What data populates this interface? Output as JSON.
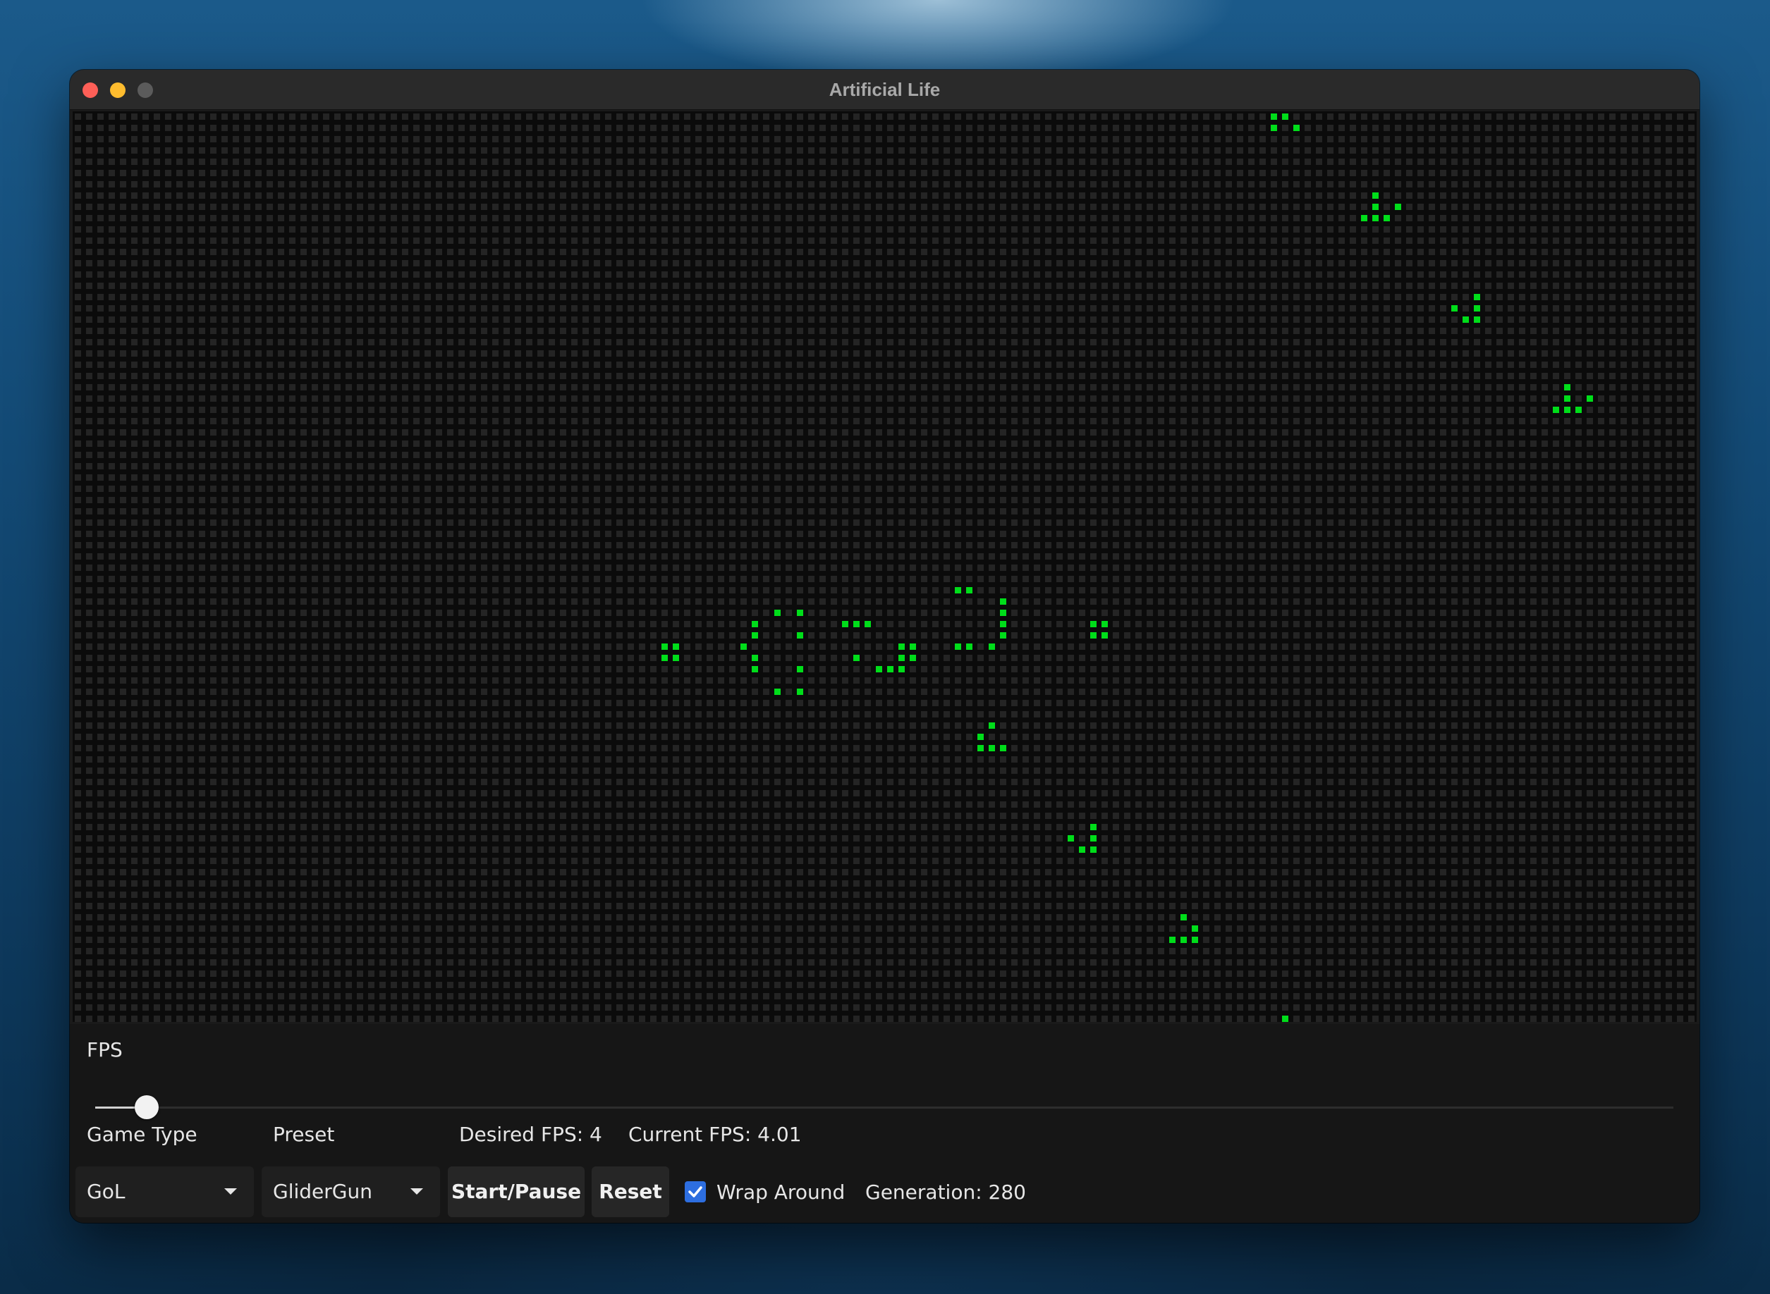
{
  "window": {
    "title": "Artificial Life"
  },
  "colors": {
    "alive": "#00dd1a",
    "dead": "#242424",
    "grid_background": "#0b0b0b",
    "accent": "#2d6ee0"
  },
  "grid": {
    "columns": 144,
    "rows": 81,
    "alive_cells": [
      [
        106,
        0
      ],
      [
        107,
        0
      ],
      [
        106,
        1
      ],
      [
        108,
        1
      ],
      [
        115,
        7
      ],
      [
        115,
        8
      ],
      [
        117,
        8
      ],
      [
        114,
        9
      ],
      [
        115,
        9
      ],
      [
        116,
        9
      ],
      [
        124,
        16
      ],
      [
        122,
        17
      ],
      [
        124,
        17
      ],
      [
        123,
        18
      ],
      [
        124,
        18
      ],
      [
        132,
        24
      ],
      [
        132,
        25
      ],
      [
        134,
        25
      ],
      [
        131,
        26
      ],
      [
        132,
        26
      ],
      [
        133,
        26
      ],
      [
        78,
        42
      ],
      [
        79,
        42
      ],
      [
        82,
        43
      ],
      [
        82,
        44
      ],
      [
        82,
        45
      ],
      [
        82,
        46
      ],
      [
        78,
        47
      ],
      [
        79,
        47
      ],
      [
        81,
        47
      ],
      [
        62,
        44
      ],
      [
        64,
        44
      ],
      [
        60,
        45
      ],
      [
        59,
        47
      ],
      [
        60,
        46
      ],
      [
        60,
        48
      ],
      [
        60,
        49
      ],
      [
        64,
        46
      ],
      [
        64,
        49
      ],
      [
        62,
        51
      ],
      [
        64,
        51
      ],
      [
        68,
        45
      ],
      [
        69,
        45
      ],
      [
        70,
        45
      ],
      [
        69,
        48
      ],
      [
        71,
        49
      ],
      [
        72,
        49
      ],
      [
        73,
        49
      ],
      [
        73,
        48
      ],
      [
        74,
        48
      ],
      [
        74,
        47
      ],
      [
        73,
        47
      ],
      [
        52,
        47
      ],
      [
        53,
        47
      ],
      [
        52,
        48
      ],
      [
        53,
        48
      ],
      [
        90,
        45
      ],
      [
        91,
        45
      ],
      [
        90,
        46
      ],
      [
        91,
        46
      ],
      [
        81,
        54
      ],
      [
        80,
        55
      ],
      [
        80,
        56
      ],
      [
        81,
        56
      ],
      [
        82,
        56
      ],
      [
        90,
        63
      ],
      [
        88,
        64
      ],
      [
        90,
        64
      ],
      [
        89,
        65
      ],
      [
        90,
        65
      ],
      [
        98,
        71
      ],
      [
        99,
        72
      ],
      [
        97,
        73
      ],
      [
        98,
        73
      ],
      [
        99,
        73
      ],
      [
        107,
        80
      ]
    ]
  },
  "controls": {
    "fps_label": "FPS",
    "fps_slider": {
      "value": 4,
      "min": 1,
      "max": 120
    },
    "game_type_label": "Game Type",
    "preset_label": "Preset",
    "desired_fps_text": "Desired FPS: 4",
    "current_fps_text": "Current FPS: 4.01",
    "game_type_value": "GoL",
    "preset_value": "GliderGun",
    "start_pause_label": "Start/Pause",
    "reset_label": "Reset",
    "wrap_around_label": "Wrap Around",
    "wrap_around_checked": true,
    "generation_text": "Generation: 280"
  },
  "icons": {
    "caret": "chevron-down-icon",
    "check": "checkmark-icon"
  }
}
